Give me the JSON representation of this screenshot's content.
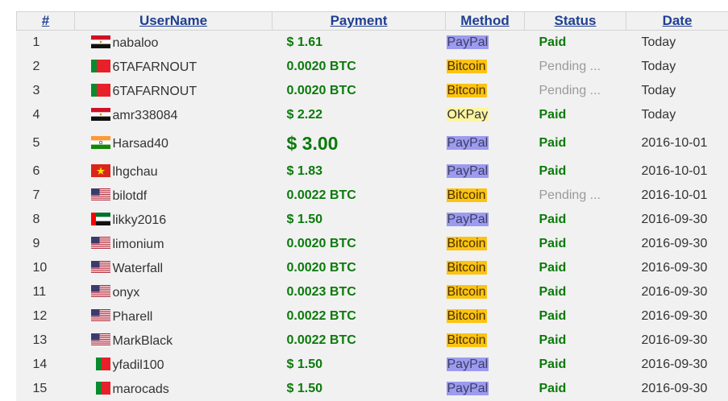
{
  "headers": [
    "#",
    "UserName",
    "Payment",
    "Method",
    "Status",
    "Date"
  ],
  "rows": [
    {
      "num": "1",
      "user": "nabaloo",
      "flag": "egypt-flag-icon",
      "payment": "$ 1.61",
      "method": "PayPal",
      "status": "Paid",
      "date": "Today"
    },
    {
      "num": "2",
      "user": "6TAFARNOUT",
      "flag": "morocco-flag-icon",
      "payment": "0.0020 BTC",
      "method": "Bitcoin",
      "status": "Pending ...",
      "date": "Today"
    },
    {
      "num": "3",
      "user": "6TAFARNOUT",
      "flag": "morocco-flag-icon",
      "payment": "0.0020 BTC",
      "method": "Bitcoin",
      "status": "Pending ...",
      "date": "Today"
    },
    {
      "num": "4",
      "user": "amr338084",
      "flag": "egypt-flag-icon",
      "payment": "$ 2.22",
      "method": "OKPay",
      "status": "Paid",
      "date": "Today"
    },
    {
      "num": "5",
      "user": "Harsad40",
      "flag": "india-flag-icon",
      "payment": "$ 3.00",
      "method": "PayPal",
      "status": "Paid",
      "date": "2016-10-01"
    },
    {
      "num": "6",
      "user": "lhgchau",
      "flag": "vietnam-flag-icon",
      "payment": "$ 1.83",
      "method": "PayPal",
      "status": "Paid",
      "date": "2016-10-01"
    },
    {
      "num": "7",
      "user": "bilotdf",
      "flag": "usa-flag-icon",
      "payment": "0.0022 BTC",
      "method": "Bitcoin",
      "status": "Pending ...",
      "date": "2016-10-01"
    },
    {
      "num": "8",
      "user": "likky2016",
      "flag": "uae-flag-icon",
      "payment": "$ 1.50",
      "method": "PayPal",
      "status": "Paid",
      "date": "2016-09-30"
    },
    {
      "num": "9",
      "user": "limonium",
      "flag": "usa-flag-icon",
      "payment": "0.0020 BTC",
      "method": "Bitcoin",
      "status": "Paid",
      "date": "2016-09-30"
    },
    {
      "num": "10",
      "user": "Waterfall",
      "flag": "usa-flag-icon",
      "payment": "0.0020 BTC",
      "method": "Bitcoin",
      "status": "Paid",
      "date": "2016-09-30"
    },
    {
      "num": "11",
      "user": "onyx",
      "flag": "usa-flag-icon",
      "payment": "0.0023 BTC",
      "method": "Bitcoin",
      "status": "Paid",
      "date": "2016-09-30"
    },
    {
      "num": "12",
      "user": "Pharell",
      "flag": "usa-flag-icon",
      "payment": "0.0022 BTC",
      "method": "Bitcoin",
      "status": "Paid",
      "date": "2016-09-30"
    },
    {
      "num": "13",
      "user": "MarkBlack",
      "flag": "usa-flag-icon",
      "payment": "0.0022 BTC",
      "method": "Bitcoin",
      "status": "Paid",
      "date": "2016-09-30"
    },
    {
      "num": "14",
      "user": "yfadil100",
      "flag": "morocco-flag-icon",
      "payment": "$ 1.50",
      "method": "PayPal",
      "status": "Paid",
      "date": "2016-09-30"
    },
    {
      "num": "15",
      "user": "marocads",
      "flag": "morocco-flag-icon",
      "payment": "$ 1.50",
      "method": "PayPal",
      "status": "Paid",
      "date": "2016-09-30"
    }
  ],
  "colors": {
    "header_link": "#1f3f91",
    "payment": "#0b7a0b",
    "paypal_bg": "#9c9bef",
    "bitcoin_bg": "#fbc313",
    "okpay_bg": "#fdf4a0",
    "pending": "#9a9a9a"
  }
}
